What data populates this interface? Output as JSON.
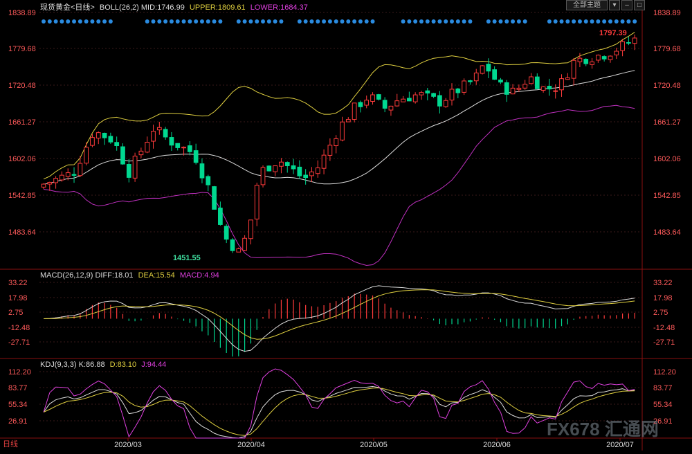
{
  "header": {
    "instrument": "现货黄金",
    "period": "<日线>",
    "boll_label": "BOLL(26,2)",
    "mid_label": "MID:1746.99",
    "upper_label": "UPPER:1809.61",
    "lower_label": "LOWER:1684.37",
    "theme_button": "全部主题"
  },
  "macd_header": {
    "label": "MACD(26,12,9)",
    "diff_label": "DIFF:18.01",
    "dea_label": "DEA:15.54",
    "macd_label": "MACD:4.94"
  },
  "kdj_header": {
    "label": "KDJ(9,3,3)",
    "k_label": "K:86.88",
    "d_label": "D:83.10",
    "j_label": "J:94.44"
  },
  "bottom_tab": "日线",
  "watermark": "FX678 汇通网",
  "colors": {
    "up": "#ff3b3b",
    "down": "#00d890",
    "upper": "#e0d040",
    "mid": "#dddddd",
    "lower": "#c030c0",
    "diff": "#dddddd",
    "dea": "#e0d040",
    "j": "#e040e0"
  },
  "chart_data": [
    {
      "type": "candlestick",
      "y_ticks": [
        "1838.89",
        "1779.68",
        "1720.48",
        "1661.27",
        "1602.06",
        "1542.85",
        "1483.64"
      ],
      "ylim": [
        1440,
        1840
      ],
      "x_ticks": [
        "2020/03",
        "2020/04",
        "2020/05",
        "2020/06",
        "2020/07"
      ],
      "annotations": {
        "high_label": "1797.39",
        "low_label": "1451.55"
      },
      "signal_dots_visible": true
    },
    {
      "type": "line",
      "name": "MACD",
      "y_ticks": [
        "33.22",
        "17.98",
        "2.75",
        "-12.48",
        "-27.71"
      ],
      "ylim": [
        -40,
        40
      ],
      "series_names": [
        "DIFF",
        "DEA",
        "MACD"
      ]
    },
    {
      "type": "line",
      "name": "KDJ",
      "y_ticks": [
        "112.20",
        "83.77",
        "55.34",
        "26.91"
      ],
      "ylim": [
        5,
        125
      ],
      "series_names": [
        "K",
        "D",
        "J"
      ]
    }
  ]
}
